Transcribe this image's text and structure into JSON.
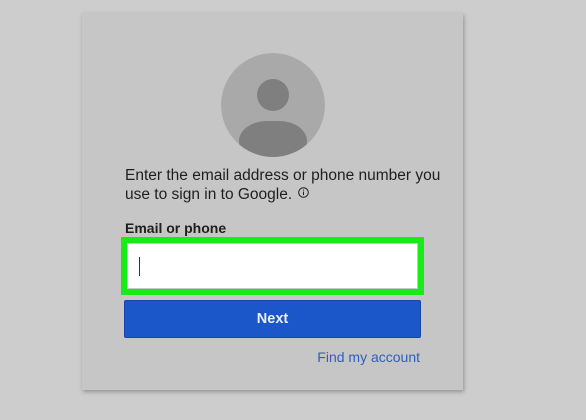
{
  "signin": {
    "prompt": "Enter the email address or phone number you use to sign in to Google.",
    "info_icon": "info-circle-icon",
    "field_label": "Email or phone",
    "email_value": "",
    "email_placeholder": "",
    "next_label": "Next",
    "find_account_label": "Find my account",
    "avatar_icon": "default-user-avatar-icon"
  },
  "colors": {
    "background": "#cdcdcd",
    "card": "#c6c6c6",
    "highlight": "#18ec18",
    "button": "#1b57c8",
    "link": "#2f5fba"
  }
}
